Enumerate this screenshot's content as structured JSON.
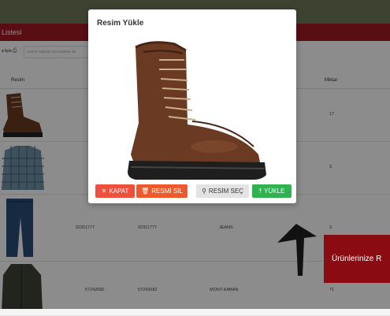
{
  "panel": {
    "title": "Listesi"
  },
  "toolbar": {
    "export_label": "a İçin",
    "search_placeholder": "Arama Yapmak İçin Anahtar Ke"
  },
  "table": {
    "headers": {
      "image": "Resim",
      "quantity": "Miktar"
    },
    "rows": [
      {
        "image": "boot-thumbnail",
        "code1": "",
        "code2": "",
        "name": "",
        "quantity": "17"
      },
      {
        "image": "shirt-thumbnail",
        "code1": "",
        "code2": "",
        "name": "",
        "quantity": "3"
      },
      {
        "image": "jeans-thumbnail",
        "code1": "02311777",
        "code2": "02311777",
        "name": "JEANS",
        "quantity": "3"
      },
      {
        "image": "jacket-thumbnail",
        "code1": "57242682",
        "code2": "57242682",
        "name": "MONT-KABAN",
        "quantity": "71"
      }
    ]
  },
  "modal": {
    "title": "Resim Yükle",
    "image": "brown-leather-boot",
    "buttons": {
      "close": "KAPAT",
      "delete": "RESMİ SİL",
      "select": "RESİM SEÇ",
      "upload": "YÜKLE"
    }
  },
  "toast": {
    "text": "Ürünlerinize R"
  },
  "colors": {
    "header": "#a11b23",
    "close": "#ef4f3d",
    "delete": "#ef5a2c",
    "upload": "#2fb24f",
    "toast": "#8a0b12"
  }
}
